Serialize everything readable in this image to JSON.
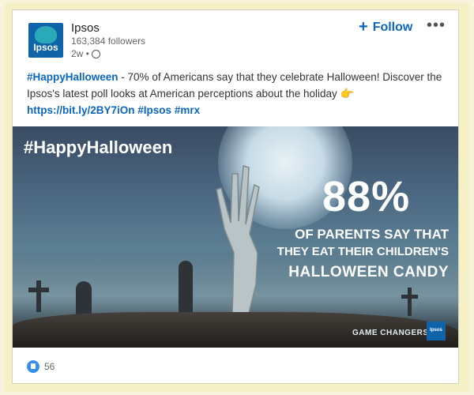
{
  "post": {
    "author": "Ipsos",
    "logo_text": "Ipsos",
    "followers": "163,384 followers",
    "time": "2w •",
    "follow_label": "Follow",
    "more_label": "•••",
    "text_hashtag": "#HappyHalloween",
    "text_body": " - 70% of Americans say that they celebrate Halloween! Discover the Ipsos's latest poll looks at American perceptions about the holiday ",
    "hand": "👉",
    "link": "https://bit.ly/2BY7iOn",
    "tag1": "#Ipsos",
    "tag2": "#mrx"
  },
  "media": {
    "hashtag": "#HappyHalloween",
    "stat": "88%",
    "line1": "OF PARENTS SAY THAT",
    "line2": "THEY EAT THEIR CHILDREN'S",
    "line3": "HALLOWEEN CANDY",
    "branding": "GAME CHANGERS",
    "mini_logo": "Ipsos"
  },
  "reactions": {
    "count": "56"
  },
  "colors": {
    "accent": "#0a66c2",
    "brand": "#0f63a8"
  },
  "icons": {
    "globe": "globe-icon",
    "like": "like-icon",
    "plus": "plus-icon",
    "more": "more-icon"
  }
}
